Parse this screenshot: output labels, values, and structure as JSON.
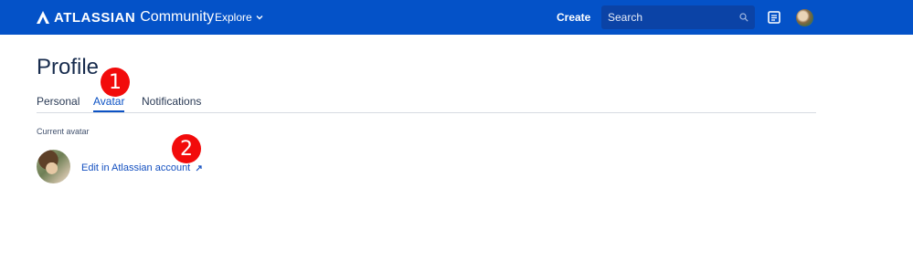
{
  "header": {
    "brand": "ATLASSIAN",
    "community": "Community",
    "explore_label": "Explore",
    "create_label": "Create",
    "search_placeholder": "Search"
  },
  "page": {
    "title": "Profile",
    "tabs": [
      {
        "label": "Personal"
      },
      {
        "label": "Avatar"
      },
      {
        "label": "Notifications"
      }
    ],
    "active_tab": "Avatar",
    "current_avatar_label": "Current avatar",
    "edit_link_label": "Edit in Atlassian account"
  },
  "annotations": [
    "1",
    "2"
  ],
  "colors": {
    "nav_background": "#0452c8",
    "accent": "#0c52c4",
    "badge": "#f20b0b"
  }
}
